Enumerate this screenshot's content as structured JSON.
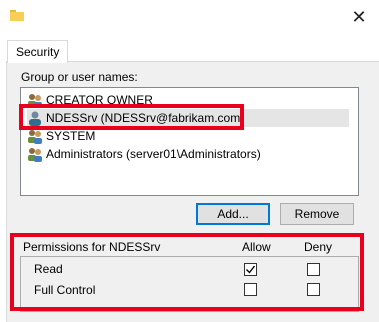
{
  "window": {
    "icon": "folder-icon",
    "close_icon": "close-icon"
  },
  "tabs": [
    {
      "label": "Security"
    }
  ],
  "group_list": {
    "label": "Group or user names:",
    "items": [
      {
        "name": "CREATOR OWNER",
        "icon": "user-group-icon"
      },
      {
        "name": "NDESSrv (NDESSrv@fabrikam.com)",
        "icon": "user-icon",
        "selected": true
      },
      {
        "name": "SYSTEM",
        "icon": "user-group-icon"
      },
      {
        "name": "Administrators (server01\\Administrators)",
        "icon": "user-group-icon"
      }
    ]
  },
  "buttons": {
    "add": "Add...",
    "remove": "Remove"
  },
  "permissions": {
    "header": "Permissions for NDESSrv",
    "allow_label": "Allow",
    "deny_label": "Deny",
    "rows": [
      {
        "label": "Read",
        "allow": true,
        "deny": false
      },
      {
        "label": "Full Control",
        "allow": false,
        "deny": false
      }
    ]
  },
  "colors": {
    "highlight": "#e8001c",
    "selection": "#e5e5e5",
    "default_button_border": "#0078d7"
  }
}
